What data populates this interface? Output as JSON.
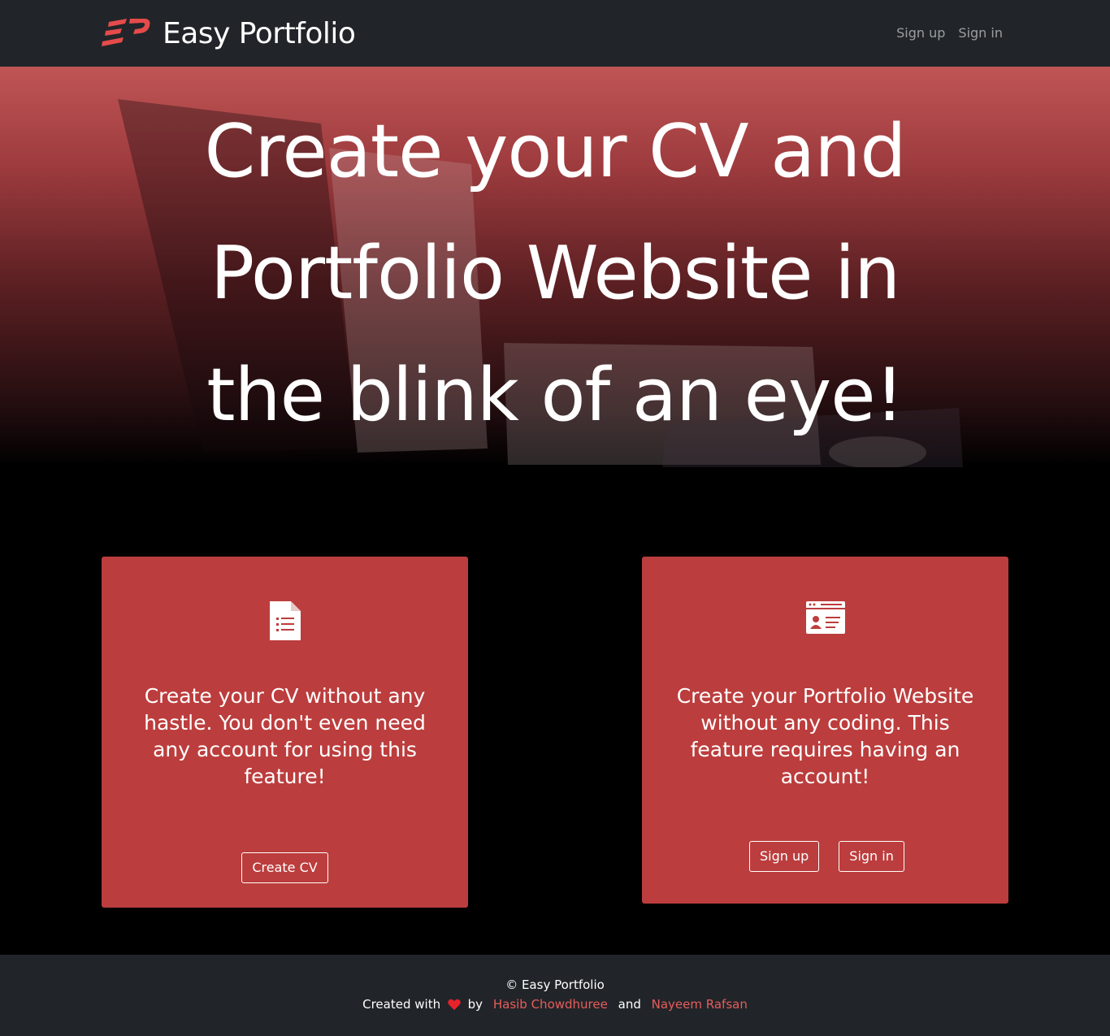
{
  "navbar": {
    "brand_name": "Easy Portfolio",
    "links": [
      {
        "label": "Sign up"
      },
      {
        "label": "Sign in"
      }
    ]
  },
  "hero": {
    "title": "Create your CV and Portfolio Website in the blink of an eye!"
  },
  "cards": {
    "cv": {
      "icon": "document-list-icon",
      "text": "Create your CV without any hastle. You don't even need any account for using this feature!",
      "button_label": "Create CV"
    },
    "portfolio": {
      "icon": "id-card-icon",
      "text": "Create your Portfolio Website without any coding. This feature requires having an account!",
      "buttons": [
        {
          "label": "Sign up"
        },
        {
          "label": "Sign in"
        }
      ]
    }
  },
  "footer": {
    "copyright": "© Easy Portfolio",
    "created_with": "Created with",
    "by": "by",
    "and": "and",
    "author1": "Hasib Chowdhuree",
    "author2": "Nayeem Rafsan"
  },
  "colors": {
    "accent": "#bc3d3d",
    "navbar_bg": "#212529",
    "link_red": "#e85c5c"
  }
}
